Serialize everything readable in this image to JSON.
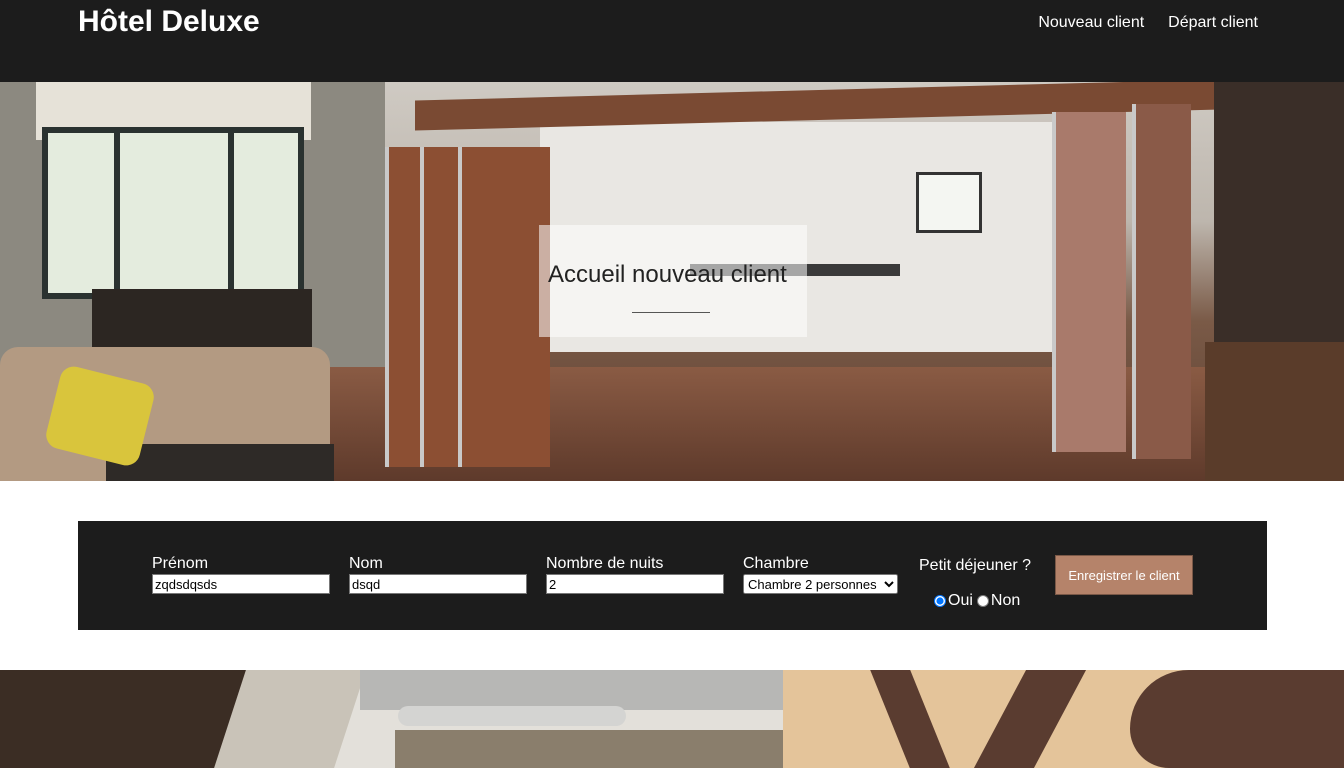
{
  "brand": "Hôtel Deluxe",
  "nav": {
    "new_client": "Nouveau client",
    "departure": "Départ client"
  },
  "hero": {
    "title": "Accueil nouveau client"
  },
  "form": {
    "first_name_label": "Prénom",
    "first_name_value": "zqdsdqsds",
    "last_name_label": "Nom",
    "last_name_value": "dsqd",
    "nights_label": "Nombre de nuits",
    "nights_value": "2",
    "room_label": "Chambre",
    "room_selected": "Chambre 2 personnes",
    "breakfast_label": "Petit déjeuner ?",
    "breakfast_yes": "Oui",
    "breakfast_no": "Non",
    "breakfast_selected": "Oui",
    "submit_label": "Enregistrer le client"
  },
  "colors": {
    "header_bg": "#1c1c1c",
    "submit_bg": "#b5836a"
  }
}
